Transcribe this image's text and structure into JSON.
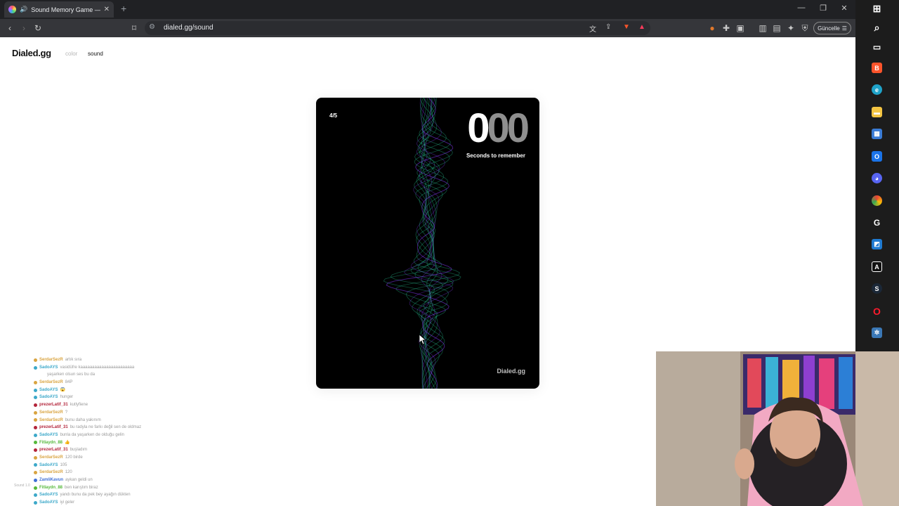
{
  "browser": {
    "tab_title": "Sound Memory Game — Ho",
    "url": "dialed.gg/sound",
    "update_label": "Güncelle"
  },
  "icons": {
    "back": "back-arrow-icon",
    "forward": "forward-arrow-icon",
    "reload": "reload-icon",
    "bookmark": "bookmark-icon",
    "new_tab": "plus-icon",
    "translate": "translate-icon",
    "share": "share-icon",
    "brave": "brave-shield-icon",
    "rewards": "brave-rewards-icon",
    "extensions": "puzzle-icon",
    "menu": "hamburger-icon"
  },
  "site": {
    "logo": "Dialed.gg",
    "nav": [
      {
        "label": "color",
        "active": false
      },
      {
        "label": "sound",
        "active": true
      }
    ]
  },
  "game": {
    "round": "4/5",
    "timer_digits": [
      "0",
      "0",
      "0"
    ],
    "timer_label": "Seconds to remember",
    "brand": "Dialed.gg"
  },
  "chat": {
    "rows": [
      {
        "user": "SerdarSezR",
        "color": "#d9a441",
        "msg": "artık sıra"
      },
      {
        "user": "SadoAYS",
        "color": "#3ca8c9",
        "msg": "vasidüfre kaaaaaaaaaaaaaaaaaaaaaaa"
      },
      {
        "user": "",
        "color": "#3ca8c9",
        "msg": "yaşarken olsun ses bu da"
      },
      {
        "user": "SerdarSezR",
        "color": "#d9a441",
        "msg": "84P"
      },
      {
        "user": "SadoAYS",
        "color": "#3ca8c9",
        "msg": "😱"
      },
      {
        "user": "SadoAYS",
        "color": "#3ca8c9",
        "msg": "hunger"
      },
      {
        "user": "prezerLatif_31",
        "color": "#b3243a",
        "msg": "kutlyfiene"
      },
      {
        "user": "SerdarSezR",
        "color": "#d9a441",
        "msg": "?"
      },
      {
        "user": "SerdarSezR",
        "color": "#d9a441",
        "msg": "bunu daha yakınım"
      },
      {
        "user": "prezerLatif_31",
        "color": "#b3243a",
        "msg": "bu radyla ne farkı değil sen de oldmaz"
      },
      {
        "user": "SadoAYS",
        "color": "#3ca8c9",
        "msg": "bunla da yaşarken de olduğu gelin"
      },
      {
        "user": "Fitlaydn_88",
        "color": "#55b83b",
        "msg": "👍"
      },
      {
        "user": "prezerLatif_31",
        "color": "#b3243a",
        "msg": "buşladım"
      },
      {
        "user": "SerdarSezR",
        "color": "#d9a441",
        "msg": "120 birde"
      },
      {
        "user": "SadoAYS",
        "color": "#3ca8c9",
        "msg": "105"
      },
      {
        "user": "SerdarSezR",
        "color": "#d9a441",
        "msg": "120"
      },
      {
        "user": "ZamliKavun",
        "color": "#3f6fd6",
        "msg": "aykan geldi un"
      },
      {
        "user": "Fitlaydn_88",
        "color": "#55b83b",
        "msg": "ben karıştım biraz"
      },
      {
        "user": "SadoAYS",
        "color": "#3ca8c9",
        "msg": "yandı bunu da pek bey ayağın dükten"
      },
      {
        "user": "SadoAYS",
        "color": "#3ca8c9",
        "msg": "iyi geler"
      }
    ],
    "sound_tag": "Sound 1.0"
  },
  "colors": {
    "card_bg": "#000000",
    "wave_green": "#2fe0a8",
    "wave_purple": "#8a3cff",
    "page_bg": "#ffffff"
  }
}
